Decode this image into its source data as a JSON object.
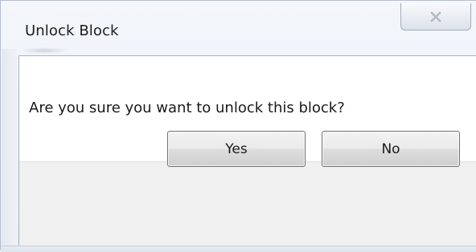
{
  "window": {
    "title": "Unlock Block"
  },
  "icons": {
    "close": "close-icon"
  },
  "message": {
    "text": "Are you sure you want to unlock this block?"
  },
  "buttons": {
    "yes_label": "Yes",
    "no_label": "No"
  },
  "colors": {
    "frame": "#edf1f7",
    "client_background": "#ffffff",
    "button_area_background": "#f0f0f0"
  }
}
